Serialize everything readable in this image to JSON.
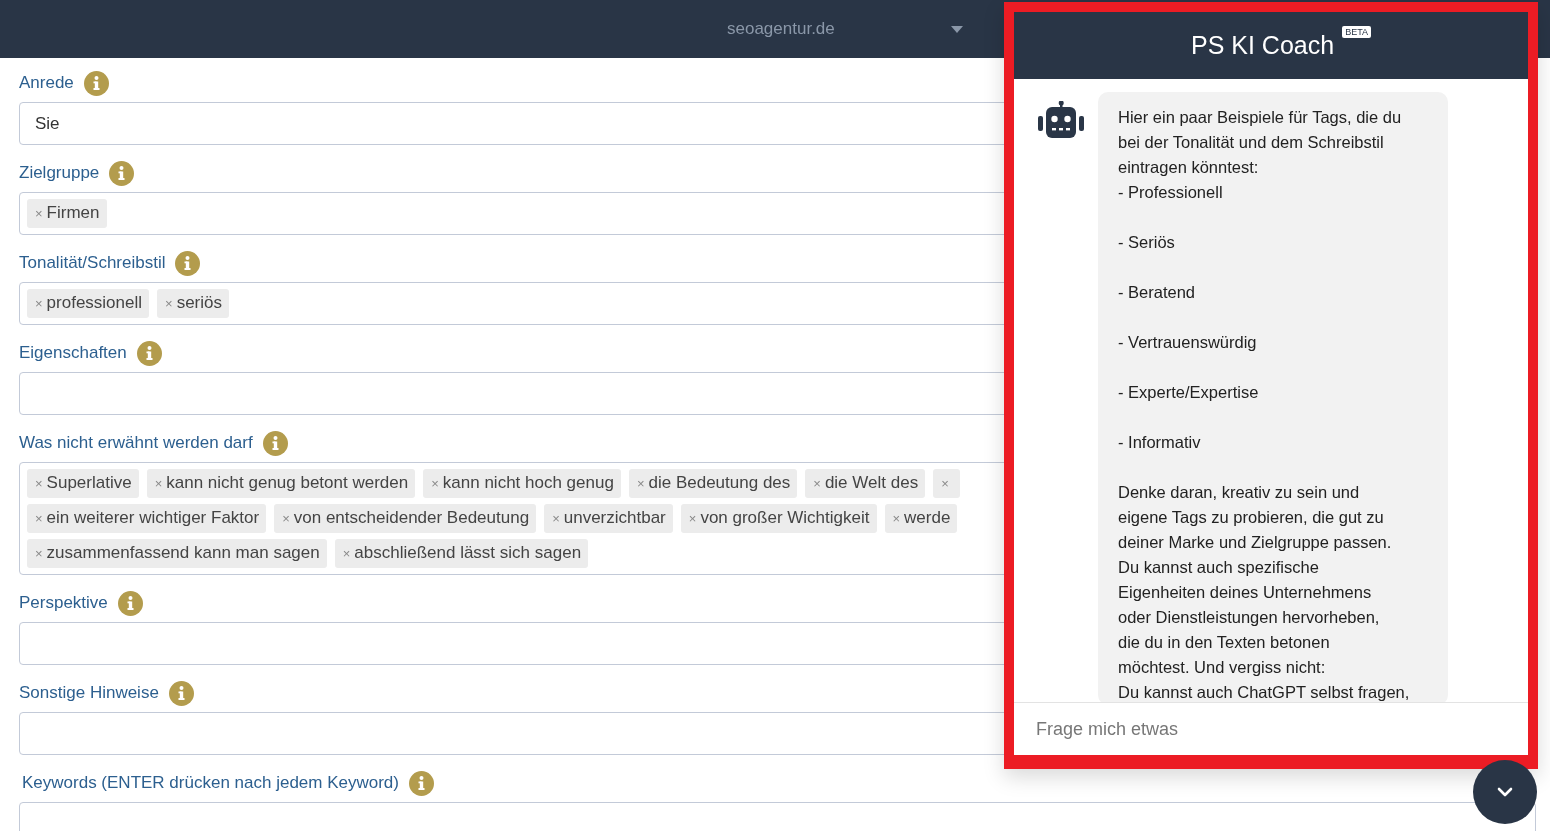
{
  "header": {
    "domain": "seoagentur.de"
  },
  "fields": [
    {
      "label": "Anrede",
      "kind": "text",
      "value": "Sie"
    },
    {
      "label": "Zielgruppe",
      "kind": "tags",
      "tag_rows": [
        [
          {
            "remove": "×",
            "label": "Firmen"
          }
        ]
      ]
    },
    {
      "label": "Tonalität/Schreibstil",
      "kind": "tags",
      "tag_rows": [
        [
          {
            "remove": "×",
            "label": "professionell"
          },
          {
            "remove": "×",
            "label": "seriös"
          }
        ]
      ]
    },
    {
      "label": "Eigenschaften",
      "kind": "text"
    },
    {
      "label": "Was nicht erwähnt werden darf",
      "kind": "tags",
      "tag_rows": [
        [
          {
            "remove": "×",
            "label": "Superlative"
          },
          {
            "remove": "×",
            "label": "kann nicht genug betont werden"
          },
          {
            "remove": "×",
            "label": "kann nicht hoch genug"
          },
          {
            "remove": "×",
            "label": "die Bedeutung des"
          },
          {
            "remove": "×",
            "label": "die Welt des"
          },
          {
            "remove": "×"
          }
        ],
        [
          {
            "remove": "×",
            "label": "ein weiterer wichtiger Faktor"
          },
          {
            "remove": "×",
            "label": "von entscheidender Bedeutung"
          },
          {
            "remove": "×",
            "label": "unverzichtbar"
          },
          {
            "remove": "×",
            "label": "von großer Wichtigkeit"
          },
          {
            "remove": "×",
            "label": "werde"
          }
        ],
        [
          {
            "remove": "×",
            "label": "zusammenfassend kann man sagen"
          },
          {
            "remove": "×",
            "label": "abschließend lässt sich sagen"
          }
        ]
      ]
    },
    {
      "label": "Perspektive",
      "kind": "text"
    },
    {
      "label": "Sonstige Hinweise",
      "kind": "text"
    },
    {
      "label": "Keywords (ENTER drücken nach jedem Keyword)",
      "kind": "text"
    }
  ],
  "chat": {
    "title": "PS KI Coach",
    "badge": "BETA",
    "message": "Hier ein paar Beispiele für Tags, die du\nbei der Tonalität und dem Schreibstil\neintragen könntest:\n- Professionell\n\n- Seriös\n\n- Beratend\n\n- Vertrauenswürdig\n\n- Experte/Expertise\n\n- Informativ\n\nDenke daran, kreativ zu sein und\neigene Tags zu probieren, die gut zu\ndeiner Marke und Zielgruppe passen.\nDu kannst auch spezifische\nEigenheiten deines Unternehmens\noder Dienstleistungen hervorheben,\ndie du in den Texten betonen\nmöchtest. Und vergiss nicht:\n Du kannst auch ChatGPT selbst fragen,",
    "placeholder": "Frage mich etwas"
  }
}
